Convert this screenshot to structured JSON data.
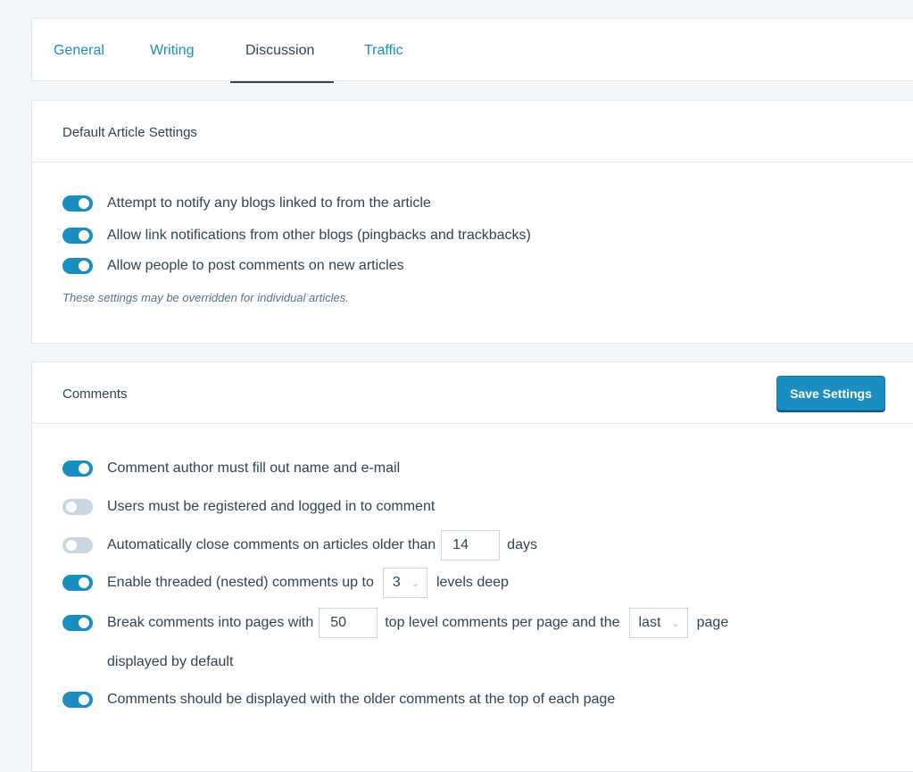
{
  "tabs": [
    {
      "label": "General"
    },
    {
      "label": "Writing"
    },
    {
      "label": "Discussion"
    },
    {
      "label": "Traffic"
    }
  ],
  "default_article": {
    "title": "Default Article Settings",
    "items": [
      {
        "label": "Attempt to notify any blogs linked to from the article",
        "on": true
      },
      {
        "label": "Allow link notifications from other blogs (pingbacks and trackbacks)",
        "on": true
      },
      {
        "label": "Allow people to post comments on new articles",
        "on": true
      }
    ],
    "hint": "These settings may be overridden for individual articles."
  },
  "comments": {
    "title": "Comments",
    "save_label": "Save Settings",
    "author_required": {
      "label": "Comment author must fill out name and e-mail",
      "on": true
    },
    "registered_only": {
      "label": "Users must be registered and logged in to comment",
      "on": false
    },
    "auto_close": {
      "label_before": "Automatically close comments on articles older than",
      "value": "14",
      "label_after": "days",
      "on": false
    },
    "threaded": {
      "label_before": "Enable threaded (nested) comments up to",
      "value": "3",
      "label_after": "levels deep",
      "on": true
    },
    "paging": {
      "label_before": "Break comments into pages with",
      "value": "50",
      "label_middle": "top level comments per page and the",
      "select_value": "last",
      "label_after": "page",
      "label_wrap": "displayed by default",
      "on": true
    },
    "order": {
      "label": "Comments should be displayed with the older comments at the top of each page",
      "on": true
    }
  },
  "colors": {
    "accent": "#1a8dc1",
    "toggle_off": "#c8d7e1",
    "text": "#2e4453"
  }
}
